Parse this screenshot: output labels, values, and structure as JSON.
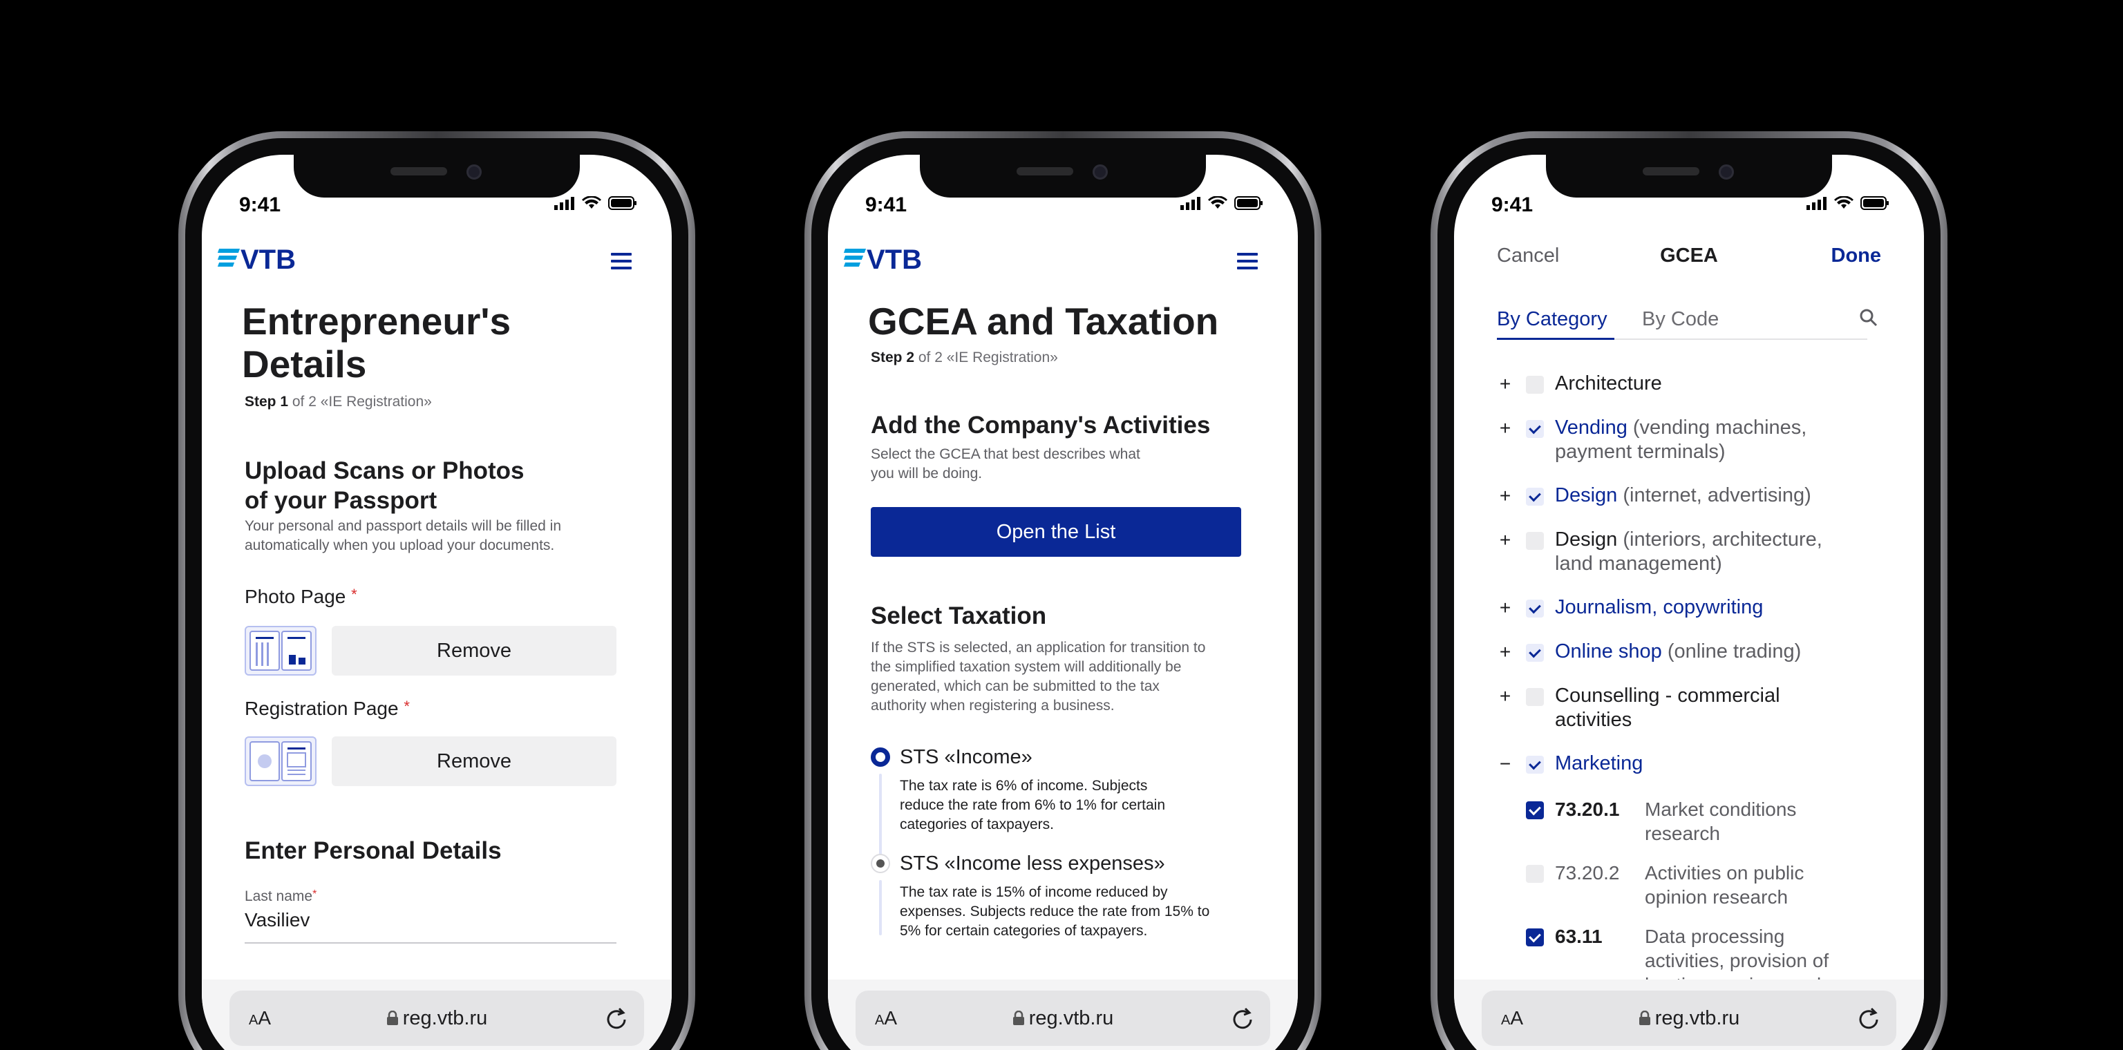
{
  "status_time": "9:41",
  "browser": {
    "aa_small": "A",
    "aa_large": "A",
    "url": "reg.vtb.ru"
  },
  "brand": {
    "logo_text": "VTB",
    "primary": "#0a2896",
    "stripe": "#009fdf"
  },
  "screen1": {
    "title_line1": "Entrepreneur's",
    "title_line2": "Details",
    "step_bold": "Step 1",
    "step_rest": " of 2 «IE Registration»",
    "upload_heading_line1": "Upload Scans or Photos",
    "upload_heading_line2": "of your Passport",
    "upload_desc_line1": "Your personal and passport details will be filled in",
    "upload_desc_line2": "automatically when you upload your documents.",
    "photo_label": "Photo Page",
    "registration_label": "Registration Page",
    "required_mark": "*",
    "remove_label": "Remove",
    "personal_heading": "Enter Personal Details",
    "last_name_label": "Last name",
    "last_name_value": "Vasiliev"
  },
  "screen2": {
    "title": "GCEA and Taxation",
    "step_bold": "Step 2",
    "step_rest": " of 2 «IE Registration»",
    "activities_heading": "Add the Company's Activities",
    "activities_desc_line1": "Select the GCEA that best describes what",
    "activities_desc_line2": "you will be doing.",
    "open_list": "Open the List",
    "taxation_heading": "Select Taxation",
    "taxation_desc": [
      "If the STS is selected, an application for transition to",
      "the simplified taxation system will additionally be",
      "generated, which can be submitted to the tax",
      "authority when registering a business."
    ],
    "options": [
      {
        "title": "STS «Income»",
        "selected": true,
        "desc": [
          "The tax rate is 6% of income. Subjects",
          "reduce the rate from 6% to 1% for certain",
          "categories of taxpayers."
        ]
      },
      {
        "title": "STS «Income less expenses»",
        "selected": false,
        "desc": [
          "The tax rate is 15% of income reduced by",
          "expenses. Subjects reduce the rate from 15% to",
          "5% for certain categories of taxpayers."
        ]
      }
    ]
  },
  "screen3": {
    "cancel": "Cancel",
    "title": "GCEA",
    "done": "Done",
    "tab_category": "By Category",
    "tab_code": "By Code",
    "categories": [
      {
        "toggle": "+",
        "checked": false,
        "name": "Architecture",
        "extra": ""
      },
      {
        "toggle": "+",
        "checked": true,
        "name": "Vending",
        "extra": " (vending machines,",
        "extra2": "payment terminals)"
      },
      {
        "toggle": "+",
        "checked": true,
        "name": "Design",
        "extra": " (internet, advertising)"
      },
      {
        "toggle": "+",
        "checked": false,
        "name": "Design",
        "extra": " (interiors, architecture,",
        "extra2": "land management)"
      },
      {
        "toggle": "+",
        "checked": true,
        "name": "Journalism, copywriting",
        "extra": ""
      },
      {
        "toggle": "+",
        "checked": true,
        "name": "Online shop",
        "extra": " (online trading)"
      },
      {
        "toggle": "+",
        "checked": false,
        "name": "Counselling - commercial",
        "extra": "",
        "extra2": "activities"
      },
      {
        "toggle": "−",
        "checked": true,
        "name": "Marketing",
        "extra": ""
      }
    ],
    "codes": [
      {
        "code": "73.20.1",
        "checked": true,
        "desc": [
          "Market conditions",
          "research"
        ]
      },
      {
        "code": "73.20.2",
        "checked": false,
        "desc": [
          "Activities on public",
          "opinion research"
        ]
      },
      {
        "code": "63.11",
        "checked": true,
        "desc": [
          "Data processing",
          "activities, provision of",
          "hosting services and"
        ]
      }
    ]
  }
}
